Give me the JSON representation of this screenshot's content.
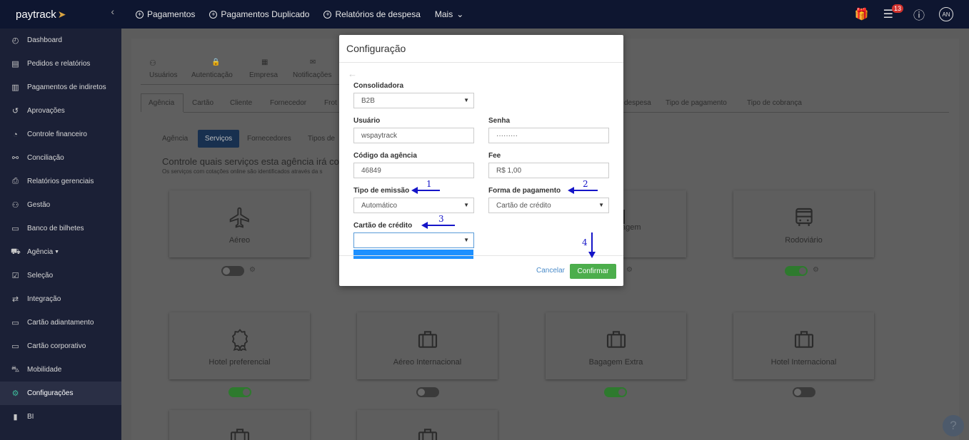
{
  "brand": {
    "name": "paytrack"
  },
  "topnav": [
    {
      "label": "Pagamentos"
    },
    {
      "label": "Pagamentos Duplicado"
    },
    {
      "label": "Relatórios de despesa"
    }
  ],
  "topnav_more": "Mais",
  "notifications_count": "13",
  "user_initials": "AN",
  "sidebar": {
    "items": [
      {
        "label": "Dashboard",
        "icon": "dashboard-icon"
      },
      {
        "label": "Pedidos e relatórios",
        "icon": "document-icon"
      },
      {
        "label": "Pagamentos de indiretos",
        "icon": "barcode-icon"
      },
      {
        "label": "Aprovações",
        "icon": "history-icon"
      },
      {
        "label": "Controle financeiro",
        "icon": "pie-chart-icon"
      },
      {
        "label": "Conciliação",
        "icon": "link-icon"
      },
      {
        "label": "Relatórios gerenciais",
        "icon": "print-icon"
      },
      {
        "label": "Gestão",
        "icon": "users-icon"
      },
      {
        "label": "Banco de bilhetes",
        "icon": "ticket-icon"
      },
      {
        "label": "Agência",
        "icon": "cart-icon"
      },
      {
        "label": "Seleção",
        "icon": "checkbox-icon"
      },
      {
        "label": "Integração",
        "icon": "sync-icon"
      },
      {
        "label": "Cartão adiantamento",
        "icon": "card-icon"
      },
      {
        "label": "Cartão corporativo",
        "icon": "card-icon"
      },
      {
        "label": "Mobilidade",
        "icon": "car-icon"
      },
      {
        "label": "Configurações",
        "icon": "gear-icon",
        "active": true
      },
      {
        "label": "BI",
        "icon": "bar-chart-icon"
      }
    ]
  },
  "settings": {
    "top_tabs": [
      "Usuários",
      "Autenticação",
      "Empresa",
      "Notificações"
    ],
    "sub_tabs": [
      "Agência",
      "Cartão",
      "Cliente",
      "Fornecedor",
      "Frot",
      "despesa",
      "Tipo de pagamento",
      "Tipo de cobrança"
    ],
    "agency_tabs": [
      "Agência",
      "Serviços",
      "Fornecedores",
      "Tipos de"
    ],
    "heading": "Controle quais serviços esta agência irá cota",
    "subheading": "Os serviços com cotações online são identificados através da s"
  },
  "services": [
    {
      "label": "Aéreo",
      "icon": "plane-icon",
      "enabled": false
    },
    {
      "label": "agem",
      "icon": "luggage-icon",
      "enabled": false
    },
    {
      "label": "Rodoviário",
      "icon": "bus-icon",
      "enabled": true
    },
    {
      "label": "Hotel preferencial",
      "icon": "award-icon",
      "enabled": true
    },
    {
      "label": "Aéreo Internacional",
      "icon": "briefcase-icon",
      "enabled": false
    },
    {
      "label": "Bagagem Extra",
      "icon": "briefcase-icon",
      "enabled": true
    },
    {
      "label": "Hotel Internacional",
      "icon": "briefcase-icon",
      "enabled": false
    }
  ],
  "modal": {
    "title": "Configuração",
    "fields": {
      "consolidadora": {
        "label": "Consolidadora",
        "value": "B2B"
      },
      "usuario": {
        "label": "Usuário",
        "value": "wspaytrack"
      },
      "senha": {
        "label": "Senha",
        "value": "·········"
      },
      "codigo": {
        "label": "Código da agência",
        "value": "46849"
      },
      "fee": {
        "label": "Fee",
        "value": "R$ 1,00"
      },
      "tipo_emissao": {
        "label": "Tipo de emissão",
        "value": "Automático"
      },
      "forma_pagamento": {
        "label": "Forma de pagamento",
        "value": "Cartão de crédito"
      },
      "cartao_credito": {
        "label": "Cartão de crédito",
        "value": ""
      }
    },
    "cancel_label": "Cancelar",
    "confirm_label": "Confirmar"
  },
  "annotations": [
    "1",
    "2",
    "3",
    "4"
  ],
  "colors": {
    "topbar": "#0e1630",
    "sidebar": "#1b2036",
    "confirm": "#4cae4c",
    "annotation": "#1515c8",
    "dropdown_highlight": "#1e90ff"
  }
}
